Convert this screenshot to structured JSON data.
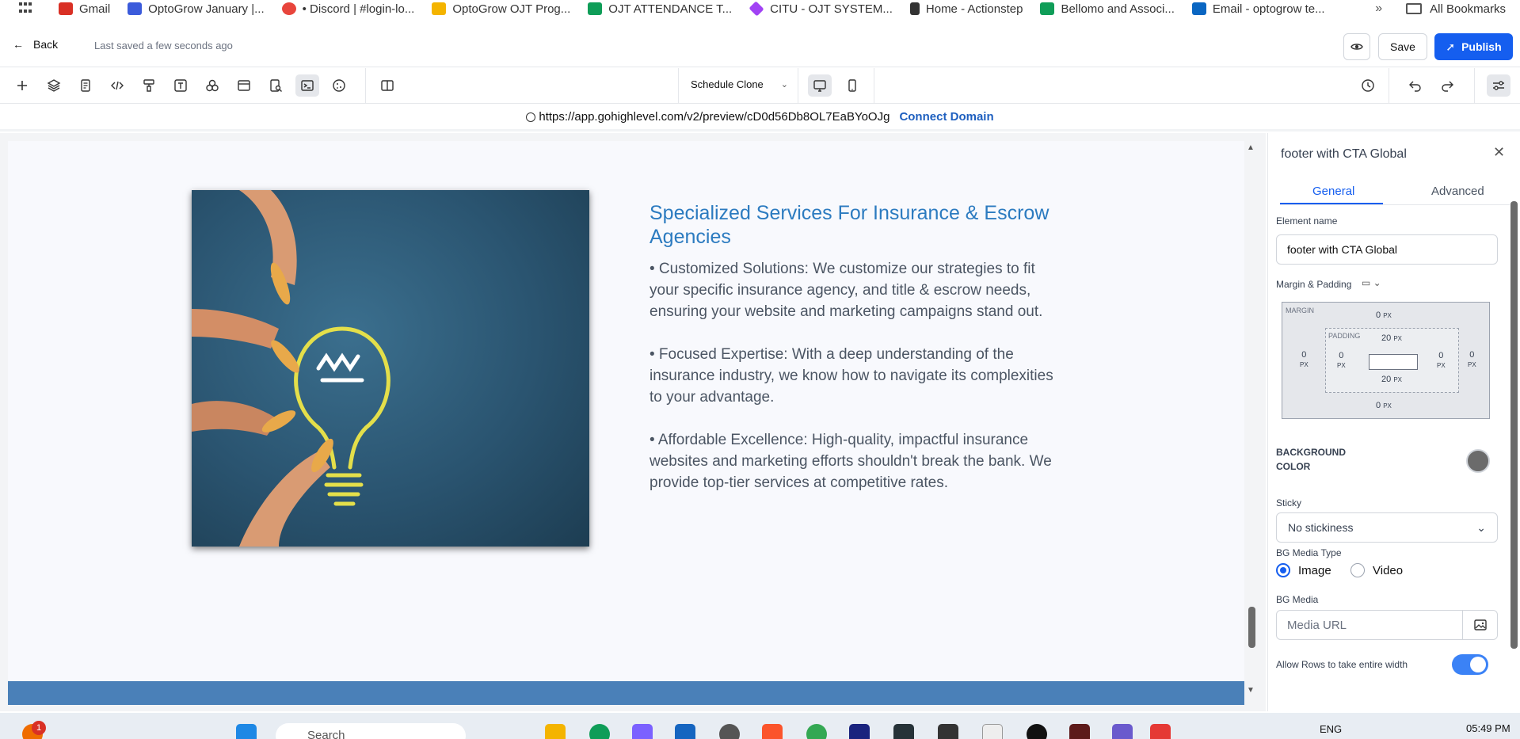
{
  "bookmarks": [
    {
      "label": "Gmail",
      "color": "#d93025"
    },
    {
      "label": "OptoGrow January |...",
      "color": "#3b5bdb"
    },
    {
      "label": "• Discord | #login-lo...",
      "color": "#e8453c"
    },
    {
      "label": "OptoGrow OJT Prog...",
      "color": "#f4b400"
    },
    {
      "label": "OJT ATTENDANCE T...",
      "color": "#0f9d58"
    },
    {
      "label": "CITU - OJT SYSTEM...",
      "color": "#a142f4"
    },
    {
      "label": "Home - Actionstep",
      "color": "#333333"
    },
    {
      "label": "Bellomo and Associ...",
      "color": "#0f9d58"
    },
    {
      "label": "Email - optogrow te...",
      "color": "#0a66c2"
    }
  ],
  "bookmarks_more": "»",
  "all_bookmarks": "All Bookmarks",
  "header": {
    "back_label": "Back",
    "last_saved": "Last saved a few seconds ago",
    "save_label": "Save",
    "publish_label": "Publish"
  },
  "toolbar": {
    "page_select": "Schedule Clone"
  },
  "urlbar": {
    "url": "https://app.gohighlevel.com/v2/preview/cD0d56Db8OL7EaBYoOJg",
    "connect_domain": "Connect Domain"
  },
  "canvas": {
    "title": "Specialized Services For Insurance & Escrow Agencies",
    "paragraphs": [
      "• Customized Solutions: We customize our strategies to fit your specific insurance agency, and title & escrow needs, ensuring your website and marketing campaigns stand out.",
      "• Focused Expertise: With a deep understanding of the insurance industry, we know how to navigate its complexities to your advantage.",
      "• Affordable Excellence: High-quality, impactful insurance websites and marketing efforts shouldn't break the bank. We provide top-tier services at competitive rates."
    ]
  },
  "panel": {
    "title": "footer with CTA Global",
    "tab_general": "General",
    "tab_advanced": "Advanced",
    "element_name_label": "Element name",
    "element_name_value": "footer with CTA Global",
    "margin_padding_label": "Margin & Padding",
    "margin_tag": "MARGIN",
    "padding_tag": "PADDING",
    "unit": "PX",
    "margin": {
      "top": "0",
      "right": "0",
      "bottom": "0",
      "left": "0"
    },
    "padding": {
      "top": "20",
      "right": "0",
      "bottom": "20",
      "left": "0"
    },
    "bg_color_label_1": "BACKGROUND",
    "bg_color_label_2": "COLOR",
    "bg_color_value": "#6b6b6b",
    "sticky_label": "Sticky",
    "sticky_value": "No stickiness",
    "bg_media_type_label": "BG Media Type",
    "media_type_image": "Image",
    "media_type_video": "Video",
    "media_type_selected": "Image",
    "bg_media_label": "BG Media",
    "media_url_placeholder": "Media URL",
    "allow_rows_label": "Allow Rows to take entire width",
    "allow_rows_on": true
  },
  "taskbar": {
    "notification_count": "1",
    "search_placeholder": "Search",
    "language": "ENG",
    "time": "05:49 PM"
  },
  "colors": {
    "accent": "#155eef",
    "heading": "#2c7bc0",
    "footer_band": "#4a80b8"
  }
}
